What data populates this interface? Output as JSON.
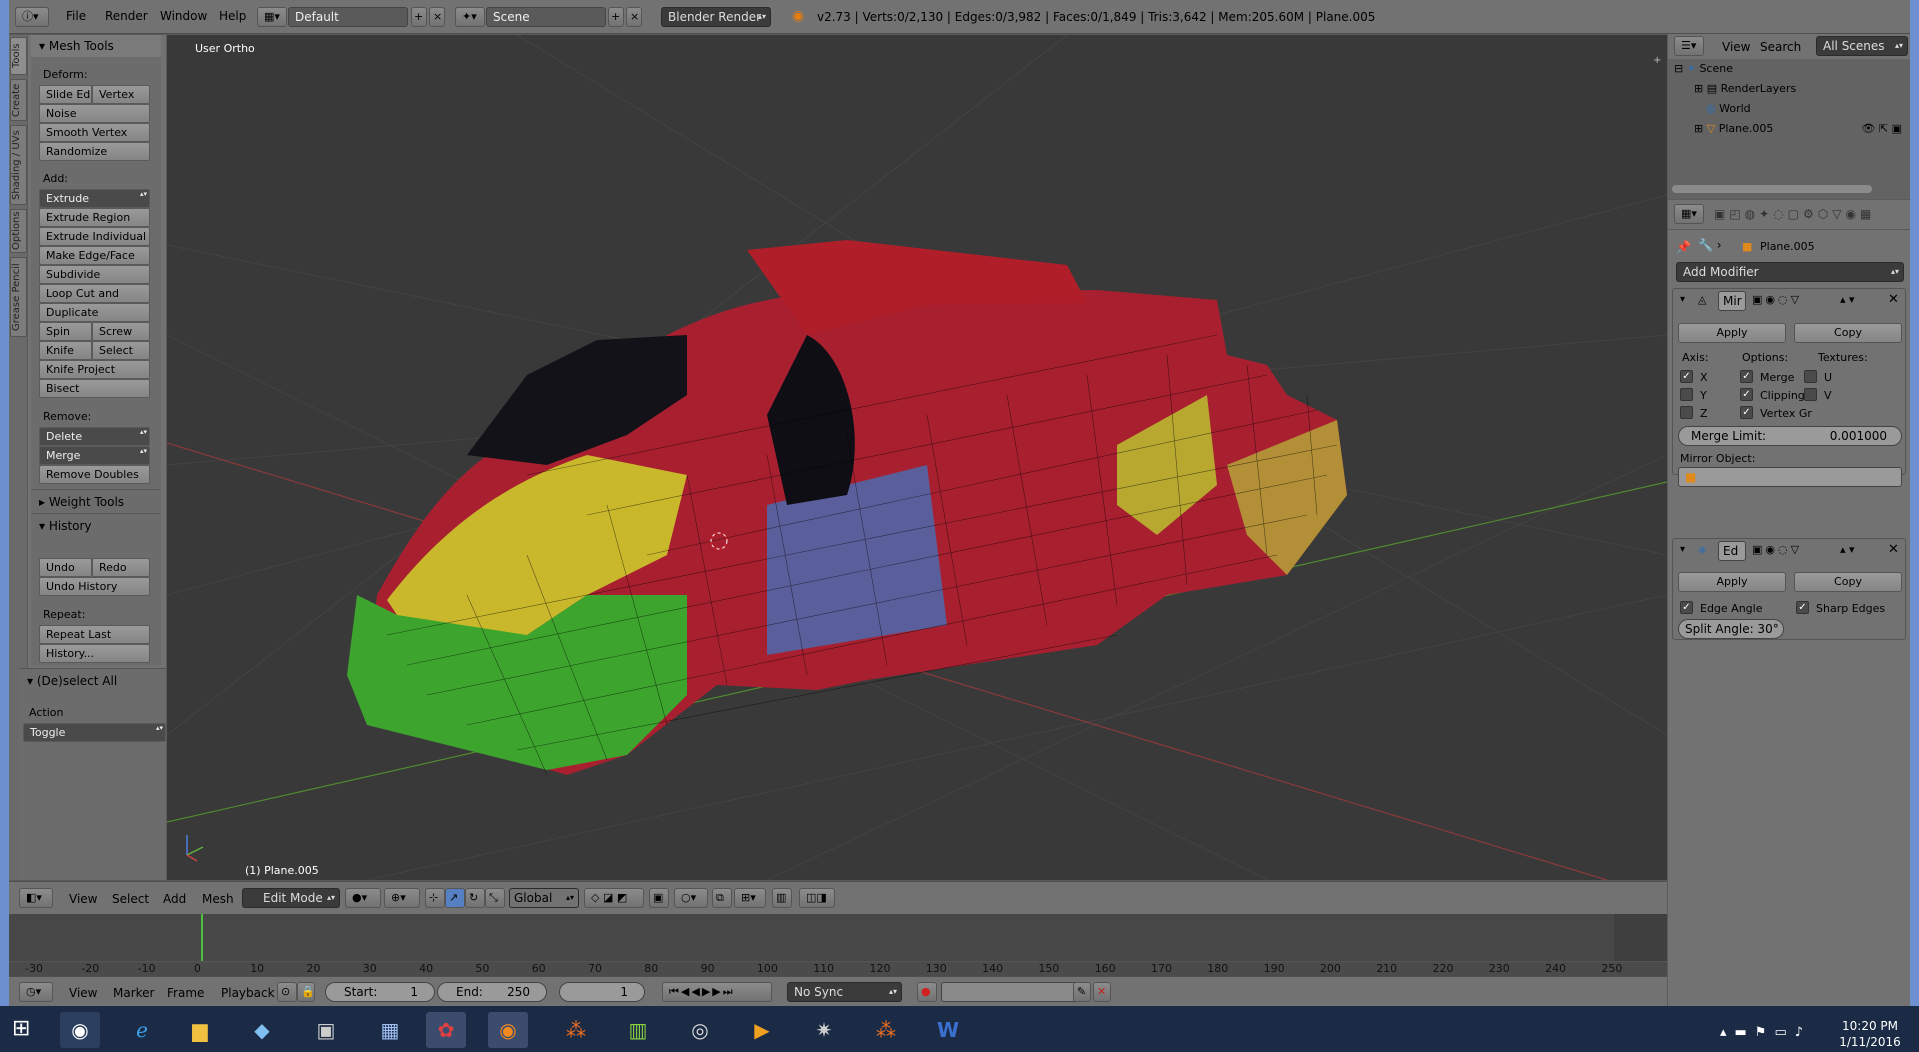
{
  "window": {
    "menus": [
      "File",
      "Render",
      "Window",
      "Help"
    ],
    "layout": "Default",
    "scene": "Scene",
    "engine": "Blender Render",
    "stats": "v2.73 | Verts:0/2,130 | Edges:0/3,982 | Faces:0/1,849 | Tris:3,642 | Mem:205.60M | Plane.005"
  },
  "shelf": {
    "tabs": [
      "Tools",
      "Create",
      "Shading / UVs",
      "Options",
      "Grease Pencil"
    ],
    "mesh_tools": "Mesh Tools",
    "deform_label": "Deform:",
    "slide_edge": "Slide Ed",
    "vertex": "Vertex",
    "noise": "Noise",
    "smooth_vertex": "Smooth Vertex",
    "randomize": "Randomize",
    "add_label": "Add:",
    "extrude": "Extrude",
    "extrude_region": "Extrude Region",
    "extrude_individual": "Extrude Individual",
    "make_edge_face": "Make Edge/Face",
    "subdivide": "Subdivide",
    "loop_cut": "Loop Cut and Slide",
    "duplicate": "Duplicate",
    "spin": "Spin",
    "screw": "Screw",
    "knife": "Knife",
    "select": "Select",
    "knife_project": "Knife Project",
    "bisect": "Bisect",
    "remove_label": "Remove:",
    "delete": "Delete",
    "merge": "Merge",
    "remove_doubles": "Remove Doubles",
    "weight_tools": "Weight Tools",
    "history": "History",
    "undo": "Undo",
    "redo": "Redo",
    "undo_history": "Undo History",
    "repeat_label": "Repeat:",
    "repeat_last": "Repeat Last",
    "history_btn": "History...",
    "deselect_all": "(De)select All",
    "action_label": "Action",
    "action_value": "Toggle"
  },
  "viewport": {
    "view_name": "User Ortho",
    "object_name": "(1) Plane.005"
  },
  "view_header": {
    "menus": [
      "View",
      "Select",
      "Add",
      "Mesh"
    ],
    "mode": "Edit Mode",
    "orientation": "Global"
  },
  "timeline": {
    "ticks": [
      "-30",
      "-20",
      "-10",
      "0",
      "10",
      "20",
      "30",
      "40",
      "50",
      "60",
      "70",
      "80",
      "90",
      "100",
      "110",
      "120",
      "130",
      "140",
      "150",
      "160",
      "170",
      "180",
      "190",
      "200",
      "210",
      "220",
      "230",
      "240",
      "250"
    ],
    "menus": [
      "View",
      "Marker",
      "Frame",
      "Playback"
    ],
    "start_label": "Start:",
    "start_value": "1",
    "end_label": "End:",
    "end_value": "250",
    "current": "1",
    "sync": "No Sync"
  },
  "outliner": {
    "menus": [
      "View",
      "Search"
    ],
    "filter": "All Scenes",
    "items": [
      "Scene",
      "RenderLayers",
      "World",
      "Plane.005"
    ]
  },
  "properties": {
    "object": "Plane.005",
    "add_modifier": "Add Modifier",
    "mirror": {
      "name": "Mir",
      "apply": "Apply",
      "copy": "Copy",
      "axis_label": "Axis:",
      "options_label": "Options:",
      "textures_label": "Textures:",
      "x": "X",
      "y": "Y",
      "z": "Z",
      "merge": "Merge",
      "clipping": "Clipping",
      "vertex_groups": "Vertex Gr",
      "u": "U",
      "v": "V",
      "merge_limit_label": "Merge Limit:",
      "merge_limit_value": "0.001000",
      "mirror_object_label": "Mirror Object:"
    },
    "edge_split": {
      "name": "Ed",
      "apply": "Apply",
      "copy": "Copy",
      "edge_angle": "Edge Angle",
      "sharp_edges": "Sharp Edges",
      "split_angle": "Split Angle: 30°"
    }
  },
  "taskbar": {
    "time": "10:20 PM",
    "date": "1/11/2016"
  }
}
